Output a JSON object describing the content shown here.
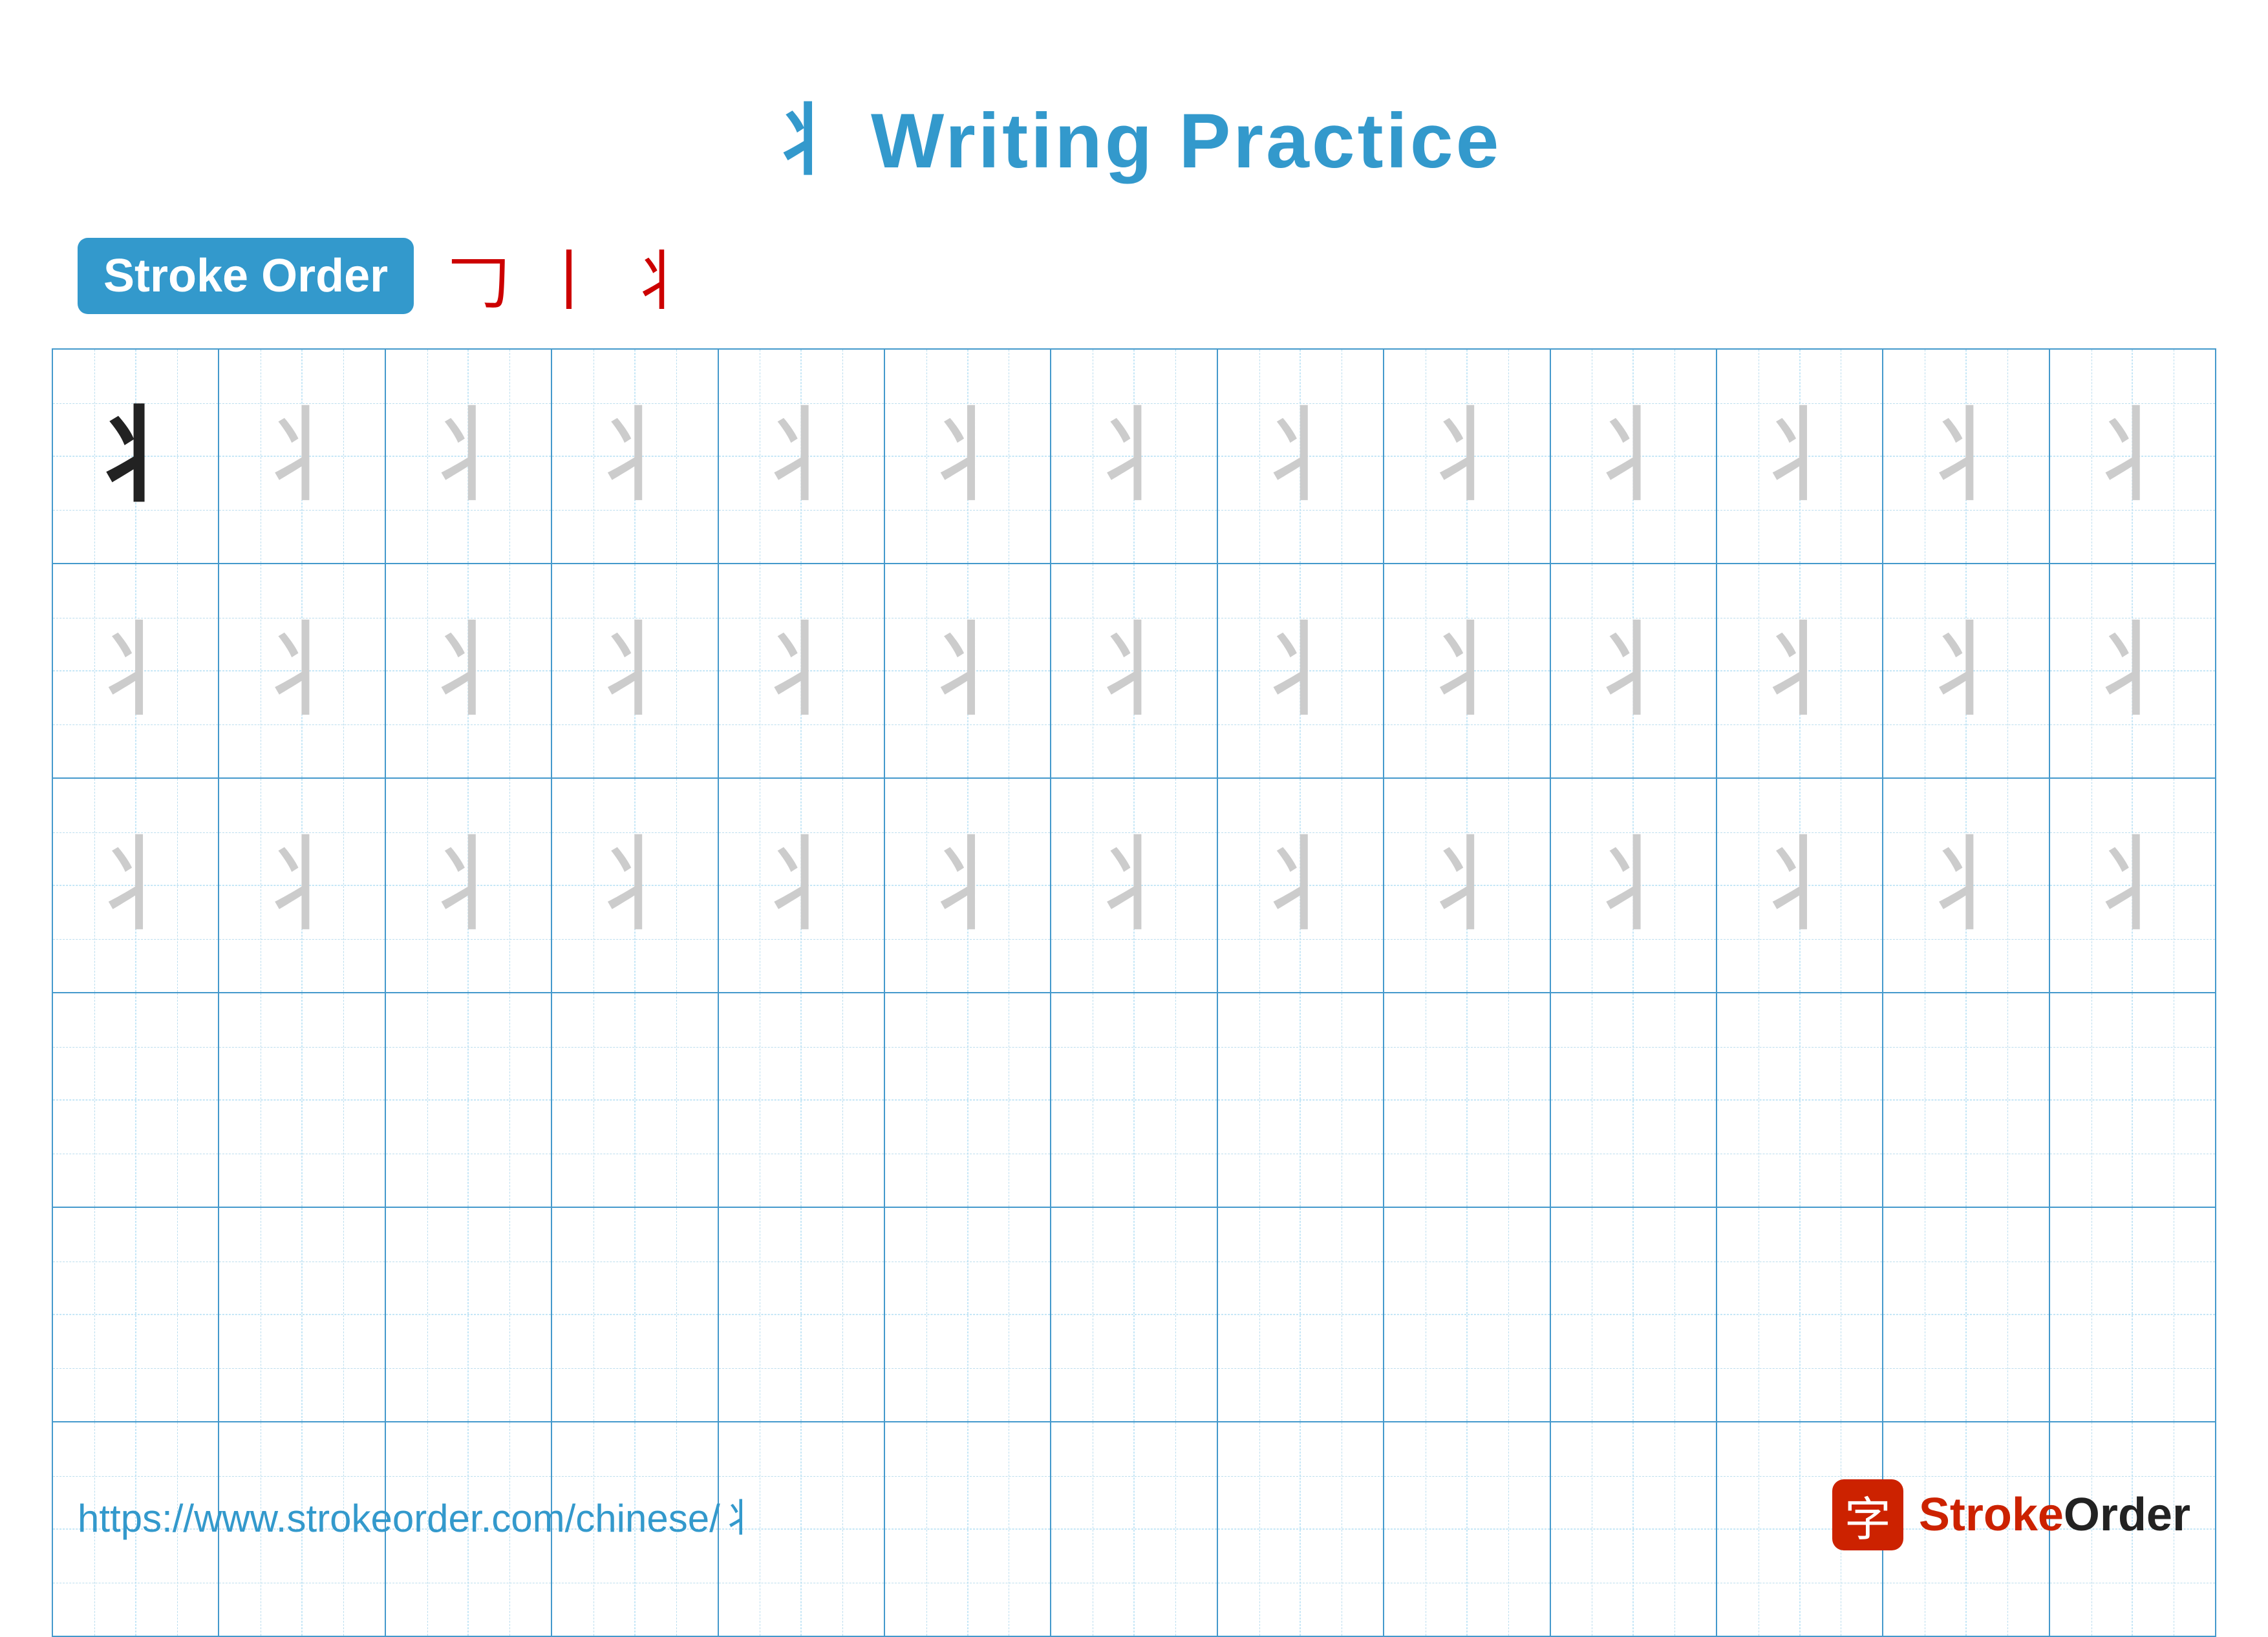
{
  "page": {
    "title": "Writing Practice",
    "title_char": "丬",
    "url": "https://www.strokeorder.com/chinese/丬",
    "brand": {
      "name": "StrokeOrder",
      "stroke": "Stroke",
      "order": "Order"
    }
  },
  "stroke_order": {
    "badge_label": "Stroke Order",
    "steps": [
      "𠃌",
      "丨",
      "丬"
    ]
  },
  "grid": {
    "cols": 13,
    "rows": 6,
    "char": "丬",
    "char_with_guide": "丬",
    "row_configs": [
      {
        "type": "practice",
        "first_dark": true,
        "faded_count": 12
      },
      {
        "type": "practice",
        "first_dark": false,
        "faded_count": 13
      },
      {
        "type": "practice",
        "first_dark": false,
        "faded_count": 13
      },
      {
        "type": "empty"
      },
      {
        "type": "empty"
      },
      {
        "type": "empty"
      }
    ]
  }
}
